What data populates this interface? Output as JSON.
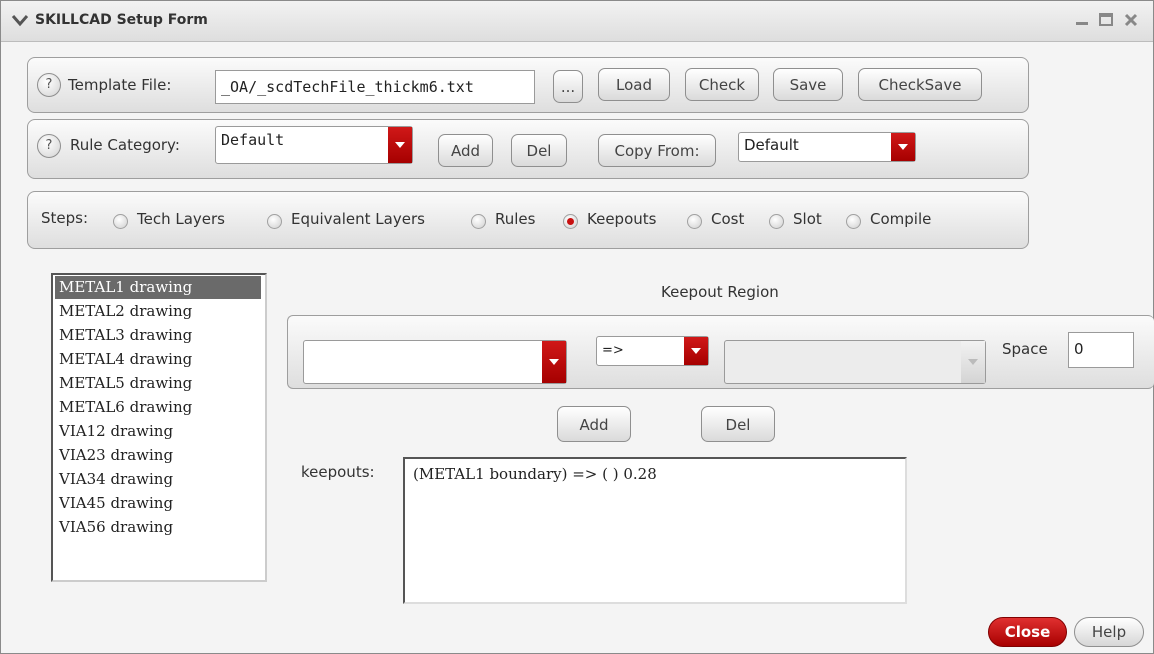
{
  "window": {
    "title": "SKILLCAD Setup Form"
  },
  "template": {
    "help": "?",
    "label": "Template File:",
    "value": "_OA/_scdTechFile_thickm6.txt",
    "browse_label": "...",
    "load_label": "Load",
    "check_label": "Check",
    "save_label": "Save",
    "checksave_label": "CheckSave"
  },
  "rule": {
    "help": "?",
    "label": "Rule Category:",
    "value": "Default",
    "add_label": "Add",
    "del_label": "Del",
    "copy_from_label": "Copy From:",
    "copy_from_value": "Default"
  },
  "steps": {
    "label": "Steps:",
    "options": [
      "Tech Layers",
      "Equivalent Layers",
      "Rules",
      "Keepouts",
      "Cost",
      "Slot",
      "Compile"
    ],
    "selected": "Keepouts"
  },
  "layers": {
    "items": [
      "METAL1 drawing",
      "METAL2 drawing",
      "METAL3 drawing",
      "METAL4 drawing",
      "METAL5 drawing",
      "METAL6 drawing",
      "VIA12 drawing",
      "VIA23 drawing",
      "VIA34 drawing",
      "VIA45 drawing",
      "VIA56 drawing"
    ],
    "selected": "METAL1 drawing"
  },
  "keepout": {
    "region_title": "Keepout Region",
    "layer_value": "",
    "operator_value": "=>",
    "target_value": "",
    "space_label": "Space",
    "space_value": "0",
    "add_label": "Add",
    "del_label": "Del",
    "list_label": "keepouts:",
    "entries": [
      "(METAL1 boundary) => ( ) 0.28"
    ]
  },
  "footer": {
    "close_label": "Close",
    "help_label": "Help"
  },
  "colors": {
    "accent": "#c00000",
    "selection": "#6a6a6a"
  }
}
